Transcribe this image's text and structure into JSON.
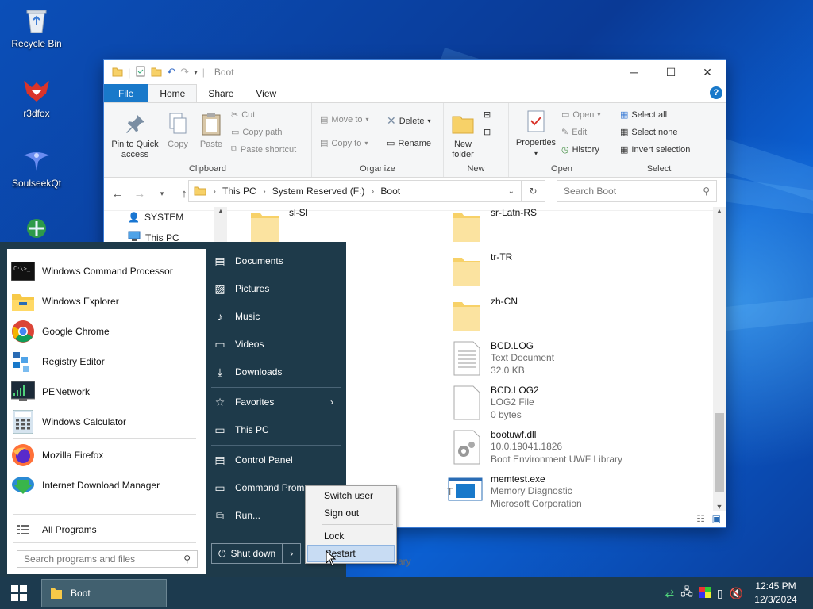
{
  "desktop": {
    "icons": [
      {
        "label": "Recycle Bin",
        "icon": "recycle-bin-icon"
      },
      {
        "label": "r3dfox",
        "icon": "r3dfox-icon"
      },
      {
        "label": "SoulseekQt",
        "icon": "soulseek-icon"
      }
    ]
  },
  "explorer": {
    "title": "Boot",
    "tabs": {
      "file": "File",
      "home": "Home",
      "share": "Share",
      "view": "View"
    },
    "ribbon": {
      "clipboard": {
        "label": "Clipboard",
        "pin": "Pin to Quick access",
        "copy": "Copy",
        "paste": "Paste",
        "cut": "Cut",
        "copy_path": "Copy path",
        "paste_shortcut": "Paste shortcut"
      },
      "organize": {
        "label": "Organize",
        "move_to": "Move to",
        "copy_to": "Copy to",
        "delete": "Delete",
        "rename": "Rename"
      },
      "new": {
        "label": "New",
        "new_folder": "New folder"
      },
      "open": {
        "label": "Open",
        "properties": "Properties",
        "open": "Open",
        "edit": "Edit",
        "history": "History"
      },
      "select": {
        "label": "Select",
        "select_all": "Select all",
        "select_none": "Select none",
        "invert": "Invert selection"
      }
    },
    "address": {
      "crumbs": [
        "This PC",
        "System Reserved (F:)",
        "Boot"
      ]
    },
    "search_placeholder": "Search Boot",
    "nav": [
      {
        "label": "SYSTEM"
      },
      {
        "label": "This PC"
      }
    ],
    "files": [
      {
        "name": "sl-SI",
        "type": "folder"
      },
      {
        "name": "sr-Latn-RS",
        "type": "folder"
      },
      {
        "name": "tr-TR",
        "type": "folder"
      },
      {
        "name": "zh-CN",
        "type": "folder"
      },
      {
        "name": "BCD.LOG",
        "line2": "Text Document",
        "line3": "32.0 KB",
        "type": "doc"
      },
      {
        "name": "BCD.LOG2",
        "line2": "LOG2 File",
        "line3": "0 bytes",
        "type": "blank"
      },
      {
        "name": "bootuwf.dll",
        "line2": "10.0.19041.1826",
        "line3": "Boot Environment UWF Library",
        "type": "dll"
      },
      {
        "name": "memtest.exe",
        "line2": "Memory Diagnostic",
        "line3": "Microsoft Corporation",
        "type": "exe"
      }
    ],
    "partial_text": {
      "t": "T",
      "library": "rary"
    }
  },
  "start_menu": {
    "programs": [
      {
        "label": "Windows Command Processor",
        "icon": "cmd-icon"
      },
      {
        "label": "Windows Explorer",
        "icon": "explorer-icon"
      },
      {
        "label": "Google Chrome",
        "icon": "chrome-icon"
      },
      {
        "label": "Registry Editor",
        "icon": "regedit-icon"
      },
      {
        "label": "PENetwork",
        "icon": "penetwork-icon"
      },
      {
        "label": "Windows Calculator",
        "icon": "calculator-icon"
      },
      {
        "label": "Mozilla Firefox",
        "icon": "firefox-icon"
      },
      {
        "label": "Internet Download Manager",
        "icon": "idm-icon"
      }
    ],
    "all_programs": "All Programs",
    "search_placeholder": "Search programs and files",
    "right_items": [
      {
        "label": "Documents",
        "icon": "document-icon"
      },
      {
        "label": "Pictures",
        "icon": "pictures-icon"
      },
      {
        "label": "Music",
        "icon": "music-icon"
      },
      {
        "label": "Videos",
        "icon": "videos-icon"
      },
      {
        "label": "Downloads",
        "icon": "downloads-icon"
      },
      {
        "label": "Favorites",
        "icon": "star-icon"
      },
      {
        "label": "This PC",
        "icon": "monitor-icon"
      },
      {
        "label": "Control Panel",
        "icon": "control-panel-icon"
      },
      {
        "label": "Command Prompt",
        "icon": "cmd-icon"
      },
      {
        "label": "Run...",
        "icon": "run-icon"
      }
    ],
    "shutdown": "Shut down"
  },
  "power_menu": {
    "items": [
      "Switch user",
      "Sign out",
      "Lock",
      "Restart"
    ],
    "highlighted": "Restart"
  },
  "taskbar": {
    "task": "Boot",
    "time": "12:45 PM",
    "date": "12/3/2024"
  }
}
